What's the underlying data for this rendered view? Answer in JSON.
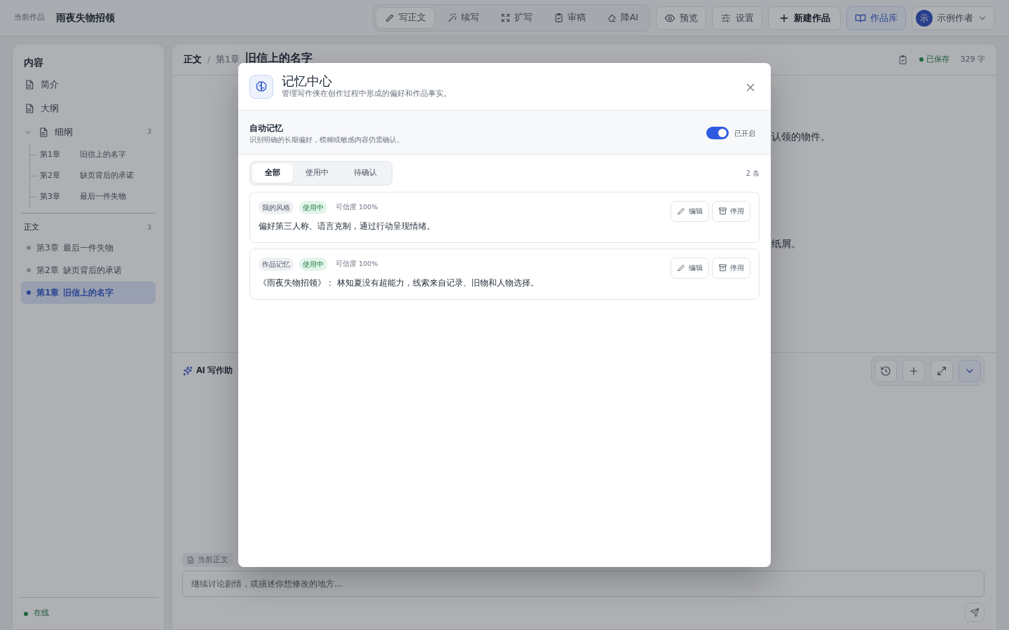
{
  "header": {
    "label": "当前作品",
    "title": "雨夜失物招领"
  },
  "toolbar": {
    "modes": [
      {
        "label": "写正文",
        "selected": true
      },
      {
        "label": "续写",
        "selected": false
      },
      {
        "label": "扩写",
        "selected": false
      },
      {
        "label": "审稿",
        "selected": false
      },
      {
        "label": "降AI",
        "selected": false
      }
    ],
    "actions": [
      {
        "label": "预览",
        "kind": "plain"
      },
      {
        "label": "设置",
        "kind": "plain"
      },
      {
        "label": "新建作品",
        "kind": "primary"
      },
      {
        "label": "作品库",
        "kind": "accent"
      }
    ],
    "user": {
      "avatar": "示",
      "name": "示例作者"
    }
  },
  "sidebar": {
    "title": "内容",
    "items": [
      {
        "label": "简介"
      },
      {
        "label": "大纲"
      },
      {
        "label": "细纲",
        "count": "3",
        "expanded": true,
        "children": [
          {
            "number": "第1章",
            "title": "旧信上的名字"
          },
          {
            "number": "第2章",
            "title": "缺页背后的承诺"
          },
          {
            "number": "第3章",
            "title": "最后一件失物"
          }
        ]
      }
    ],
    "body_section": {
      "title": "正文",
      "count": "3",
      "chapters": [
        {
          "number": "第3章",
          "title": "最后一件失物",
          "selected": false
        },
        {
          "number": "第2章",
          "title": "缺页背后的承诺",
          "selected": false
        },
        {
          "number": "第1章",
          "title": "旧信上的名字",
          "selected": true
        }
      ]
    },
    "status": {
      "label": "在线",
      "online": true
    }
  },
  "editor": {
    "breadcrumb": [
      "正文",
      "第1章"
    ],
    "separator": "/",
    "chapter_title": "旧信上的名字",
    "saved": true,
    "save_status": "已保存",
    "word_count": "329 字",
    "visible_lines": [
      "认领的物件。",
      "纸屑。"
    ]
  },
  "assistant": {
    "title": "AI 写作助",
    "context_chip": "当前正文",
    "input": {
      "placeholder": "继续讨论剧情，或描述你想修改的地方..."
    }
  },
  "modal": {
    "title": "记忆中心",
    "subtitle": "管理写作侠在创作过程中形成的偏好和作品事实。",
    "auto_memory": {
      "title": "自动记忆",
      "description": "识别明确的长期偏好，模糊或敏感内容仍需确认。",
      "on": true,
      "state_label": "已开启"
    },
    "tabs": [
      {
        "label": "全部",
        "selected": true
      },
      {
        "label": "使用中",
        "selected": false
      },
      {
        "label": "待确认",
        "selected": false
      }
    ],
    "count": "2 条",
    "memories": [
      {
        "category": "我的风格",
        "status": "使用中",
        "active": true,
        "confidence": "可信度 100%",
        "text": "偏好第三人称、语言克制，通过行动呈现情绪。",
        "actions": [
          "编辑",
          "停用"
        ]
      },
      {
        "category": "作品记忆",
        "status": "使用中",
        "active": true,
        "confidence": "可信度 100%",
        "text": "《雨夜失物招领》： 林知夏没有超能力，线索来自记录、旧物和人物选择。",
        "actions": [
          "编辑",
          "停用"
        ]
      }
    ]
  }
}
